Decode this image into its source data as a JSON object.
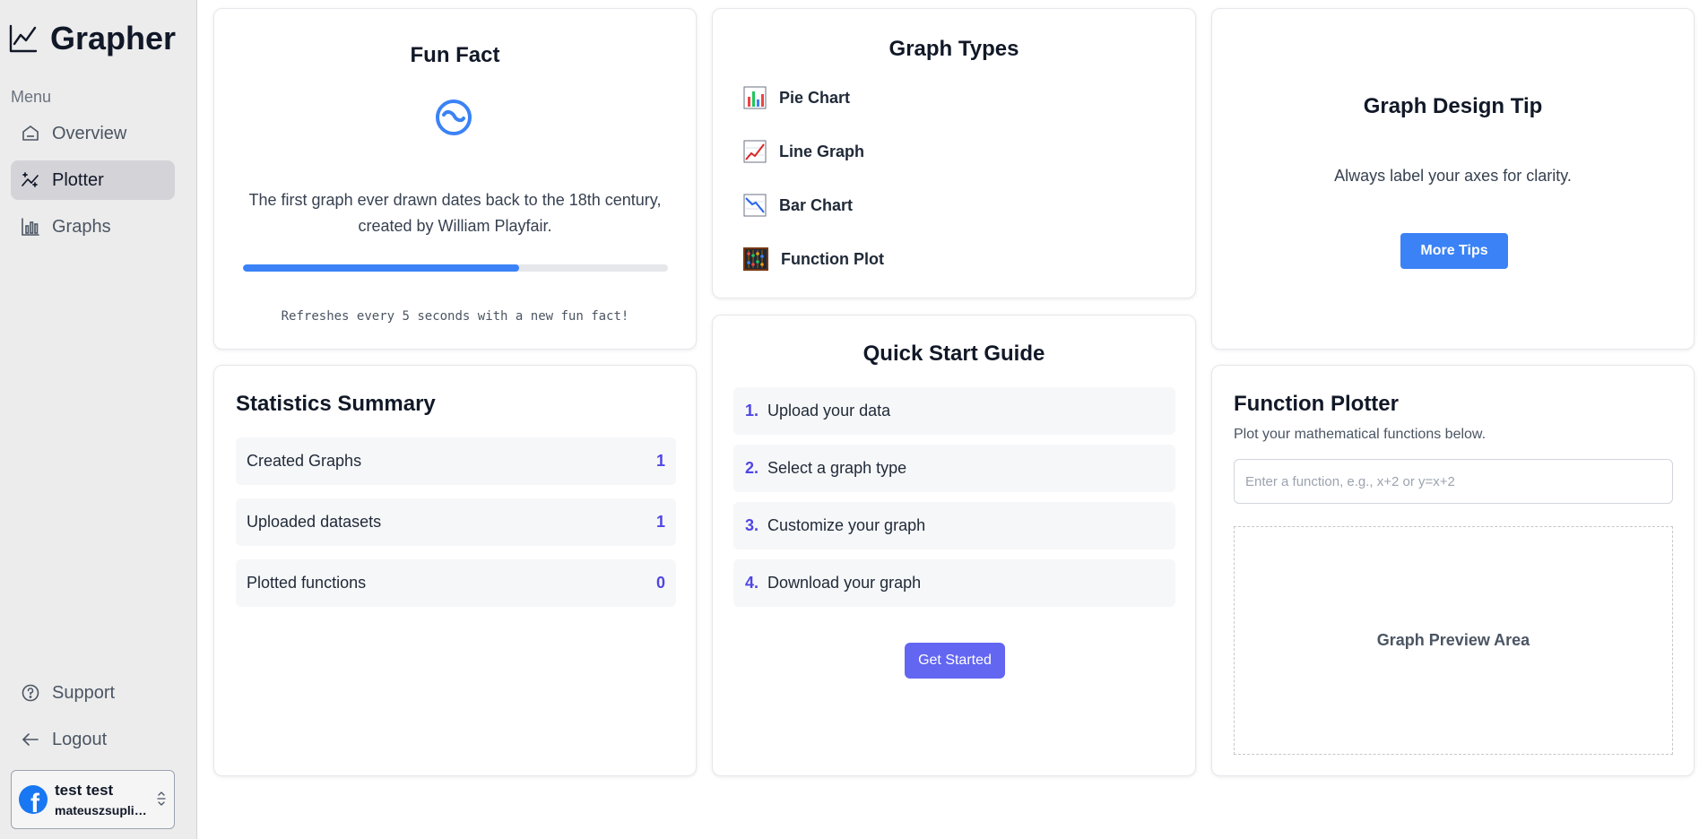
{
  "app": {
    "title": "Grapher"
  },
  "sidebar": {
    "menu_label": "Menu",
    "items": [
      {
        "label": "Overview",
        "icon": "home-icon"
      },
      {
        "label": "Plotter",
        "icon": "sparkle-chart-icon",
        "active": true
      },
      {
        "label": "Graphs",
        "icon": "bar-chart-icon"
      }
    ],
    "bottom_items": [
      {
        "label": "Support",
        "icon": "help-circle-icon"
      },
      {
        "label": "Logout",
        "icon": "arrow-left-icon"
      }
    ],
    "user": {
      "name": "test test",
      "email": "mateuszsuplic...",
      "provider_icon": "facebook-icon"
    }
  },
  "fun_fact": {
    "title": "Fun Fact",
    "icon": "loading-spinner-icon",
    "text": "The first graph ever drawn dates back to the 18th century, created by William Playfair.",
    "progress": 0.65,
    "footnote": "Refreshes every 5 seconds with a new fun fact!"
  },
  "graph_types": {
    "title": "Graph Types",
    "items": [
      {
        "label": "Pie Chart",
        "icon": "bar-chart-emoji-icon"
      },
      {
        "label": "Line Graph",
        "icon": "chart-increasing-icon"
      },
      {
        "label": "Bar Chart",
        "icon": "chart-decreasing-icon"
      },
      {
        "label": "Function Plot",
        "icon": "abacus-icon"
      }
    ]
  },
  "design_tip": {
    "title": "Graph Design Tip",
    "text": "Always label your axes for clarity.",
    "button_label": "More Tips"
  },
  "stats": {
    "title": "Statistics Summary",
    "rows": [
      {
        "label": "Created Graphs",
        "value": "1"
      },
      {
        "label": "Uploaded datasets",
        "value": "1"
      },
      {
        "label": "Plotted functions",
        "value": "0"
      }
    ]
  },
  "quick_start": {
    "title": "Quick Start Guide",
    "steps": [
      {
        "num": "1.",
        "label": "Upload your data"
      },
      {
        "num": "2.",
        "label": "Select a graph type"
      },
      {
        "num": "3.",
        "label": "Customize your graph"
      },
      {
        "num": "4.",
        "label": "Download your graph"
      }
    ],
    "button_label": "Get Started"
  },
  "plotter": {
    "title": "Function Plotter",
    "subtitle": "Plot your mathematical functions below.",
    "input_value": "",
    "input_placeholder": "Enter a function, e.g., x+2 or y=x+2",
    "preview_label": "Graph Preview Area"
  },
  "colors": {
    "accent_blue": "#3b82f6",
    "accent_indigo": "#6366f1",
    "stat_value": "#4f46e5",
    "sidebar_bg": "#ececec"
  }
}
